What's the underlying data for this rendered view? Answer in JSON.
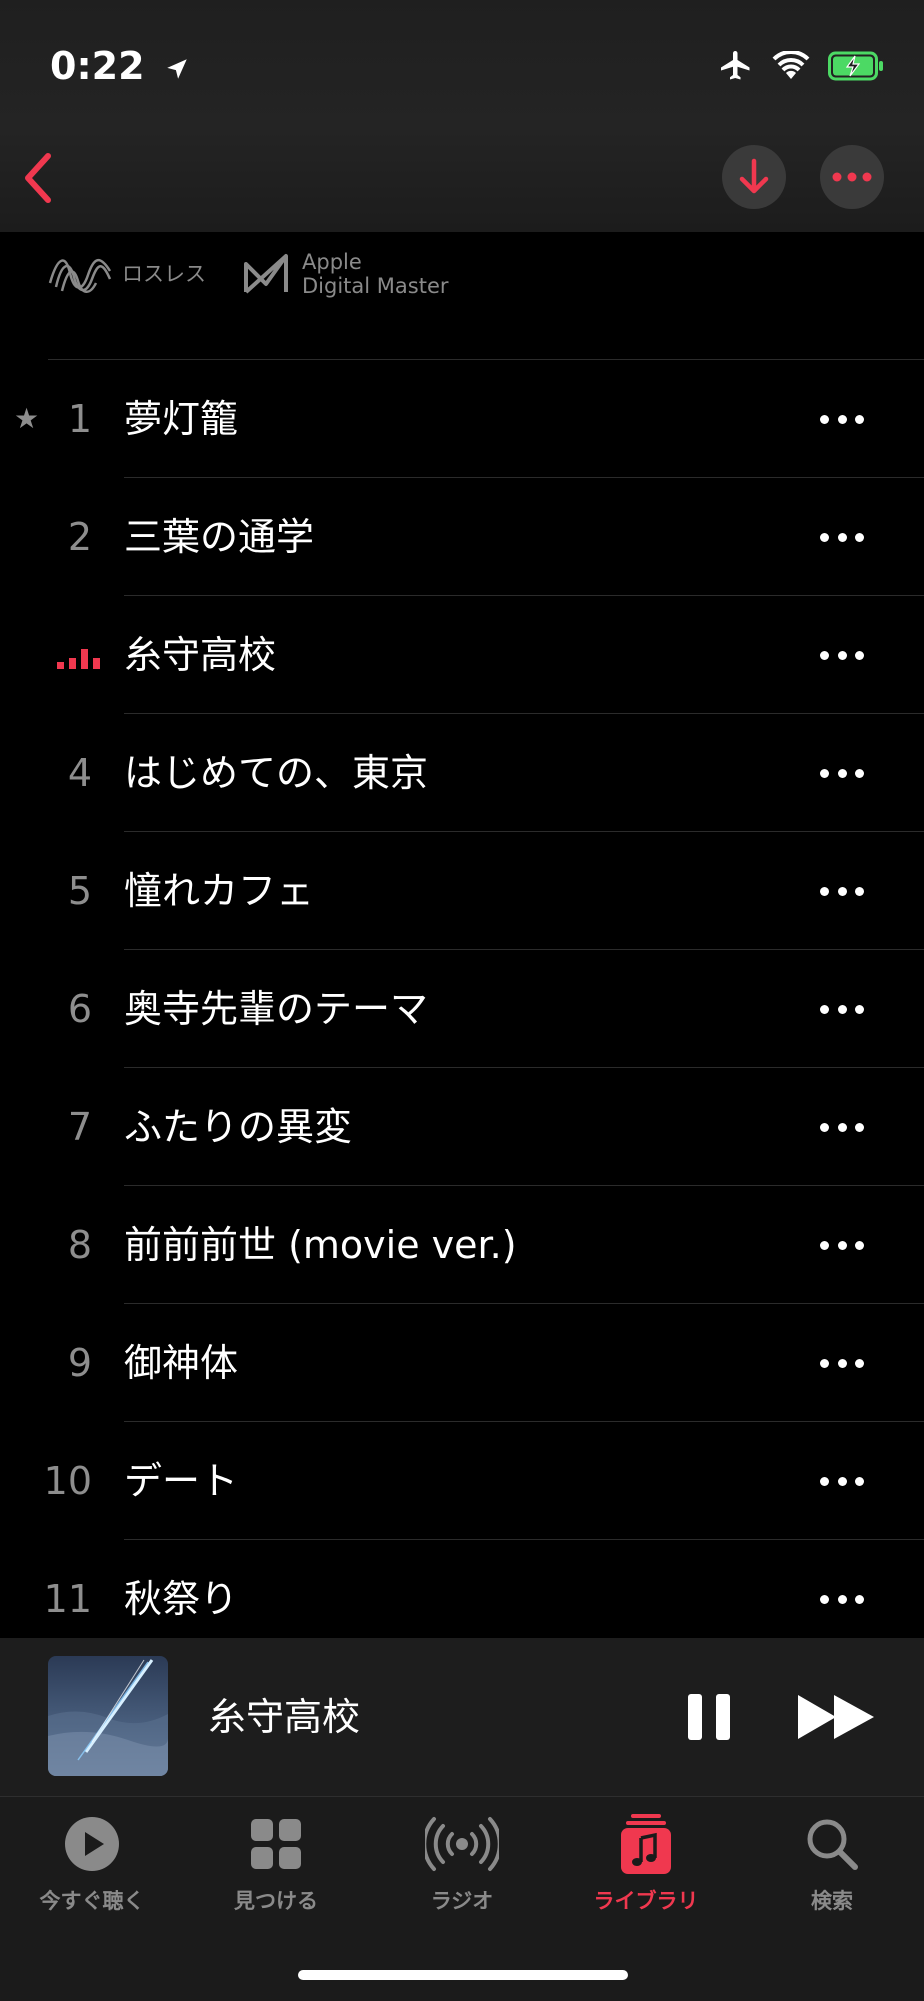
{
  "status": {
    "time": "0:22"
  },
  "badges": {
    "lossless": "ロスレス",
    "adm_line1": "Apple",
    "adm_line2": "Digital Master"
  },
  "tracks": [
    {
      "number": "1",
      "title": "夢灯籠",
      "favorite": true
    },
    {
      "number": "2",
      "title": "三葉の通学"
    },
    {
      "number": "3",
      "title": "糸守高校",
      "playing": true
    },
    {
      "number": "4",
      "title": "はじめての、東京"
    },
    {
      "number": "5",
      "title": "憧れカフェ"
    },
    {
      "number": "6",
      "title": "奥寺先輩のテーマ"
    },
    {
      "number": "7",
      "title": "ふたりの異変"
    },
    {
      "number": "8",
      "title": "前前前世 (movie ver.)"
    },
    {
      "number": "9",
      "title": "御神体"
    },
    {
      "number": "10",
      "title": "デート"
    },
    {
      "number": "11",
      "title": "秋祭り"
    }
  ],
  "now_playing": {
    "title": "糸守高校"
  },
  "tabs": [
    {
      "label": "今すぐ聴く",
      "icon": "play-circle-icon"
    },
    {
      "label": "見つける",
      "icon": "grid-icon"
    },
    {
      "label": "ラジオ",
      "icon": "radio-icon"
    },
    {
      "label": "ライブラリ",
      "icon": "library-icon",
      "active": true
    },
    {
      "label": "検索",
      "icon": "search-icon"
    }
  ],
  "colors": {
    "accent": "#f0384f",
    "background": "#000000",
    "secondary_text": "#8e8e8e"
  }
}
